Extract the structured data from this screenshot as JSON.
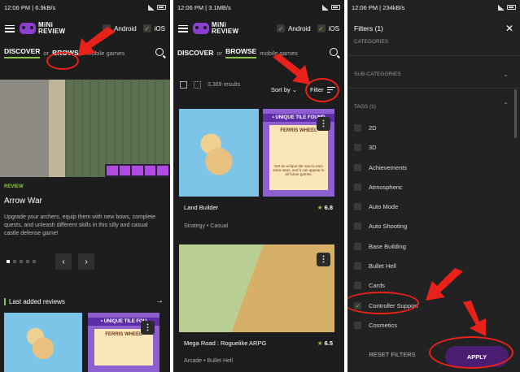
{
  "s1": {
    "status": {
      "time": "12:06 PM | 6.9kB/s"
    },
    "logo": {
      "line1": "MiNi",
      "line2": "REVIEW"
    },
    "platforms": {
      "android": "Android",
      "ios": "iOS"
    },
    "tabs": {
      "discover": "DISCOVER",
      "or": "or",
      "browse": "BROWSE",
      "suffix": "mobile games"
    },
    "featured": {
      "tag": "REVIEW",
      "title": "Arrow War",
      "desc": "Upgrade your archers, equip them with new bows, complete quests, and unleash different skills in this silly and casual castle defense game!"
    },
    "nav": {
      "prev": "‹",
      "next": "›"
    },
    "last_reviews": {
      "title": "Last added reviews",
      "arrow": "→"
    },
    "card": {
      "band": "• UNIQUE TILE FOU",
      "inner": "FERRIS WHEEL"
    }
  },
  "s2": {
    "status": {
      "time": "12:06 PM | 3.1MB/s"
    },
    "logo": {
      "line1": "MiNi",
      "line2": "REVIEW"
    },
    "platforms": {
      "android": "Android",
      "ios": "iOS"
    },
    "tabs": {
      "discover": "DISCOVER",
      "or": "or",
      "browse": "BROWSE",
      "suffix": "mobile games"
    },
    "results": "3,369 results",
    "sort": "Sort by",
    "filter": "Filter",
    "games": [
      {
        "name": "Land Builder",
        "tags": "Strategy  •  Casual",
        "score": "6.8",
        "band": "• UNIQUE TILE FOUND",
        "inner": "FERRIS WHEEL",
        "sub": "Get an unique tile now to earn extra stars, and it can appear in all future games."
      },
      {
        "name": "Mega Road : Roguelike ARPG",
        "tags": "Arcade  •  Bullet Hell",
        "score": "6.5"
      }
    ]
  },
  "s3": {
    "status": {
      "time": "12:06 PM | 234kB/s"
    },
    "title": "Filters (1)",
    "close": "✕",
    "sections": {
      "categories": "CATEGORIES",
      "sub_categories": "SUB-CATEGORIES",
      "tags": "TAGS (1)"
    },
    "tags": [
      {
        "label": "2D",
        "checked": false
      },
      {
        "label": "3D",
        "checked": false
      },
      {
        "label": "Achievements",
        "checked": false
      },
      {
        "label": "Atmospheric",
        "checked": false
      },
      {
        "label": "Auto Mode",
        "checked": false
      },
      {
        "label": "Auto Shooting",
        "checked": false
      },
      {
        "label": "Base Building",
        "checked": false
      },
      {
        "label": "Bullet Hell",
        "checked": false
      },
      {
        "label": "Cards",
        "checked": false
      },
      {
        "label": "Controller Support",
        "checked": true
      },
      {
        "label": "Cosmetics",
        "checked": false
      }
    ],
    "reset": "RESET FILTERS",
    "apply": "APPLY"
  },
  "colors": {
    "accent": "#8bc34a",
    "purple": "#8a3fd1",
    "highlight": "#e8221b"
  }
}
